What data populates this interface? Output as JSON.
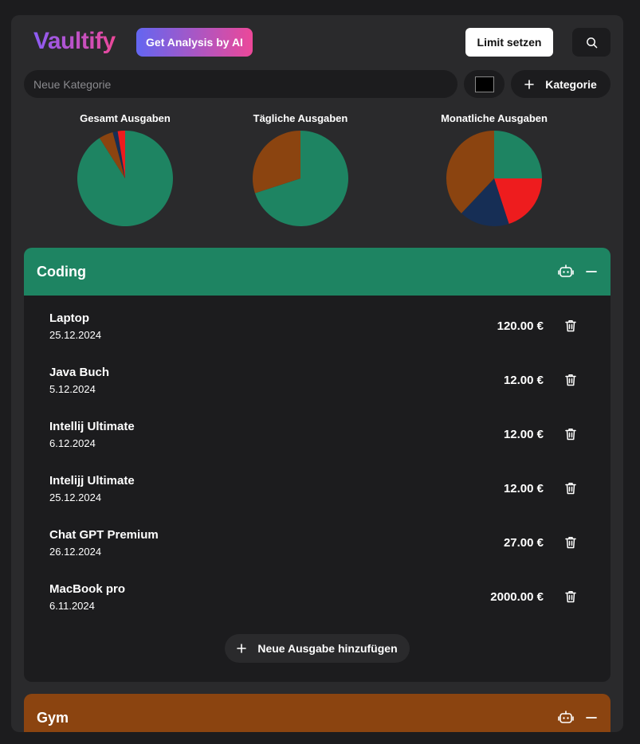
{
  "header": {
    "logo": "Vaultify",
    "ai_button": "Get Analysis by AI",
    "limit_button": "Limit setzen",
    "search_icon": "search-icon"
  },
  "new_category": {
    "placeholder": "Neue Kategorie",
    "color": "#000000",
    "add_button": "Kategorie"
  },
  "colors": {
    "coding": "#1e8462",
    "gym": "#8b4410",
    "red": "#ee1c1e",
    "navy": "#162e55",
    "brand_start": "#8b5cf6",
    "brand_end": "#ec4899"
  },
  "charts": [
    {
      "title": "Gesamt Ausgaben",
      "slices": [
        {
          "value": 2179,
          "color": "#1e8462"
        },
        {
          "value": 115,
          "color": "#8b4410"
        },
        {
          "value": 40,
          "color": "#162e55"
        },
        {
          "value": 60,
          "color": "#ee1c1e"
        }
      ]
    },
    {
      "title": "Tägliche Ausgaben",
      "slices": [
        {
          "value": 70,
          "color": "#1e8462"
        },
        {
          "value": 30,
          "color": "#8b4410"
        }
      ]
    },
    {
      "title": "Monatliche Ausgaben",
      "slices": [
        {
          "value": 25,
          "color": "#1e8462"
        },
        {
          "value": 20,
          "color": "#ee1c1e"
        },
        {
          "value": 17,
          "color": "#162e55"
        },
        {
          "value": 38,
          "color": "#8b4410"
        }
      ]
    }
  ],
  "categories": [
    {
      "name": "Coding",
      "color": "#1e8462",
      "expenses": [
        {
          "name": "Laptop",
          "date": "25.12.2024",
          "amount": "120.00 €"
        },
        {
          "name": "Java Buch",
          "date": "5.12.2024",
          "amount": "12.00 €"
        },
        {
          "name": "Intellij Ultimate",
          "date": "6.12.2024",
          "amount": "12.00 €"
        },
        {
          "name": "Intelijj Ultimate",
          "date": "25.12.2024",
          "amount": "12.00 €"
        },
        {
          "name": "Chat GPT Premium",
          "date": "26.12.2024",
          "amount": "27.00 €"
        },
        {
          "name": "MacBook pro",
          "date": "6.11.2024",
          "amount": "2000.00 €"
        }
      ],
      "add_expense": "Neue Ausgabe hinzufügen"
    },
    {
      "name": "Gym",
      "color": "#8b4410"
    }
  ]
}
